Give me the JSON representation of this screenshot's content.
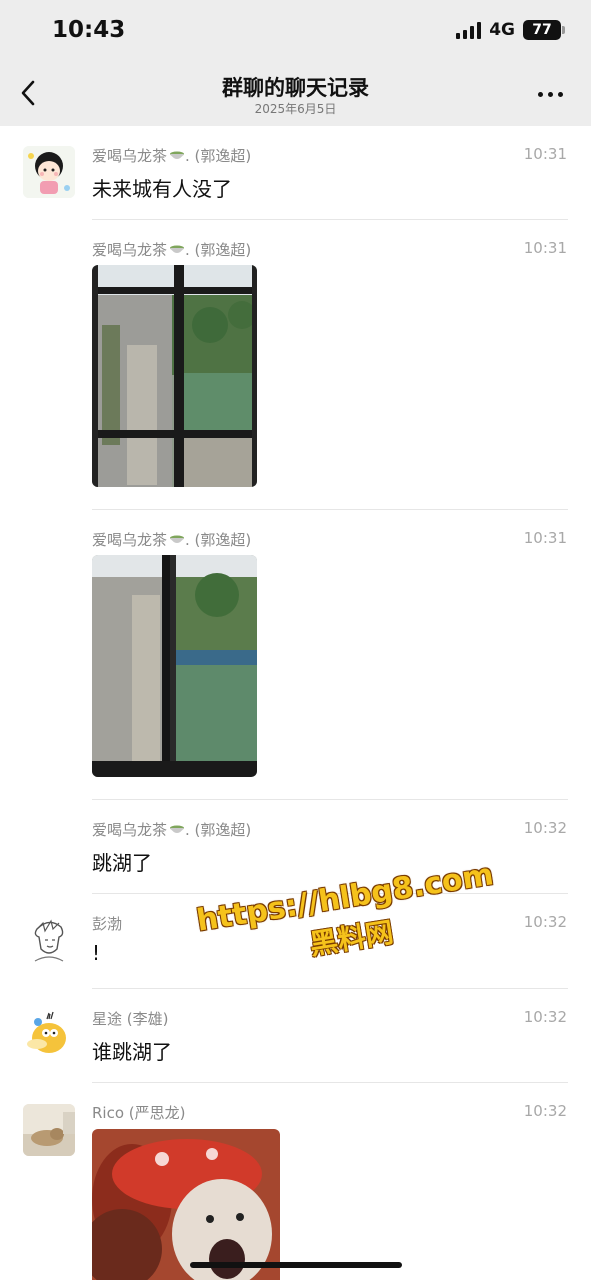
{
  "status_bar": {
    "time": "10:43",
    "network": "4G",
    "battery": "77"
  },
  "header": {
    "title": "群聊的聊天记录",
    "date": "2025年6月5日"
  },
  "messages": [
    {
      "sender": "爱喝乌龙茶",
      "sender_suffix": ". (郭逸超)",
      "time": "10:31",
      "text": "未来城有人没了"
    },
    {
      "sender": "爱喝乌龙茶",
      "sender_suffix": ". (郭逸超)",
      "time": "10:31"
    },
    {
      "sender": "爱喝乌龙茶",
      "sender_suffix": ". (郭逸超)",
      "time": "10:31"
    },
    {
      "sender": "爱喝乌龙茶",
      "sender_suffix": ". (郭逸超)",
      "time": "10:32",
      "text": "跳湖了"
    },
    {
      "sender": "彭渤",
      "time": "10:32",
      "text": "!"
    },
    {
      "sender": "星途 (李雄)",
      "time": "10:32",
      "text": "谁跳湖了"
    },
    {
      "sender": "Rico (严思龙)",
      "time": "10:32"
    }
  ],
  "watermark": {
    "url": "https://hlbg8.com",
    "site": "黑料网"
  },
  "icons": {
    "back": "chevron-left-icon",
    "more": "more-dots-icon",
    "tea": "tea-cup-emoji-icon"
  }
}
